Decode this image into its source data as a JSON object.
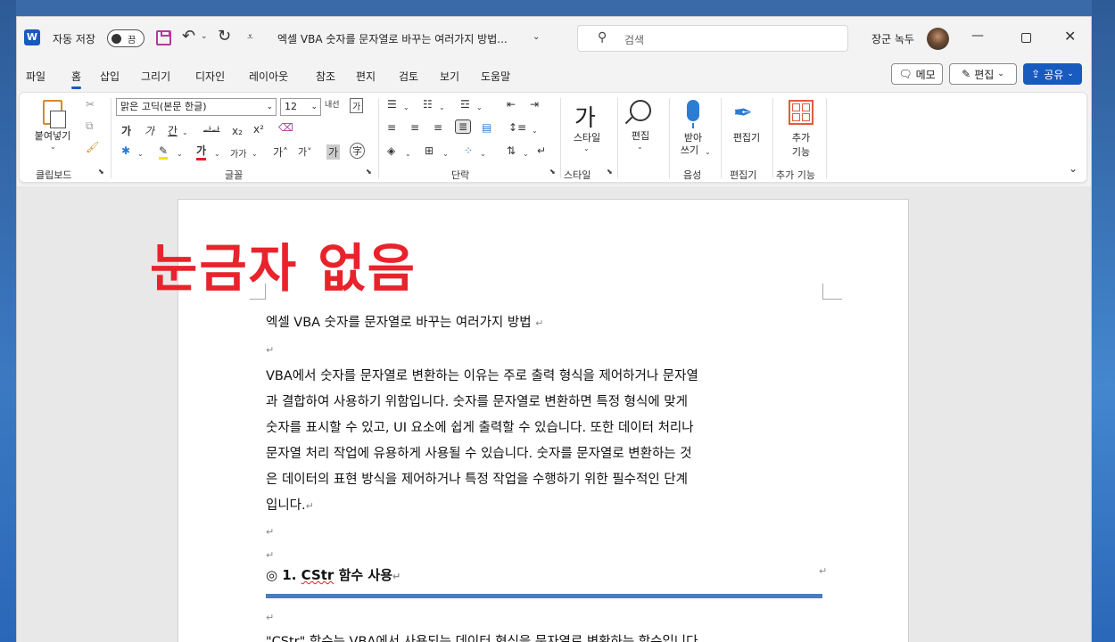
{
  "titlebar": {
    "app_icon": "W",
    "autosave_label": "자동 저장",
    "autosave_toggle": "끔",
    "doc_title": "엑셀 VBA 숫자를 문자열로 바꾸는 여러가지 방법...",
    "search_placeholder": "검색",
    "user_name": "장군 녹두"
  },
  "tabs": [
    "파일",
    "홈",
    "삽입",
    "그리기",
    "디자인",
    "레이아웃",
    "참조",
    "편지",
    "검토",
    "보기",
    "도움말"
  ],
  "active_tab": "홈",
  "actions": {
    "memo": "메모",
    "edit": "편집",
    "share": "공유"
  },
  "ribbon": {
    "clipboard": {
      "paste": "붙여넣기",
      "label": "클립보드"
    },
    "font": {
      "family": "맑은 고딕(본문 한글)",
      "size": "12",
      "label": "글꼴"
    },
    "paragraph": {
      "label": "단락"
    },
    "styles": {
      "button": "스타일",
      "label": "스타일"
    },
    "editing": {
      "button": "편집"
    },
    "voice": {
      "button_line1": "받아",
      "button_line2": "쓰기",
      "label": "음성"
    },
    "editor": {
      "button": "편집기",
      "label": "편집기"
    },
    "addins": {
      "button_line1": "추가",
      "button_line2": "기능",
      "label": "추가 기능"
    }
  },
  "document": {
    "overlay": "눈금자 없음",
    "title_line": "엑셀 VBA 숫자를 문자열로 바꾸는 여러가지 방법",
    "para_lines": [
      "VBA에서 숫자를 문자열로 변환하는 이유는 주로 출력 형식을 제어하거나 문자열",
      "과 결합하여 사용하기 위함입니다. 숫자를 문자열로 변환하면 특정 형식에 맞게",
      "숫자를 표시할 수 있고, UI 요소에 쉽게 출력할 수 있습니다. 또한 데이터 처리나",
      "문자열 처리 작업에 유용하게 사용될 수 있습니다. 숫자를 문자열로 변환하는 것",
      "은 데이터의 표현 방식을 제어하거나 특정 작업을 수행하기 위한 필수적인 단계",
      "입니다."
    ],
    "heading_prefix": "◎ 1. ",
    "heading_func": "CStr",
    "heading_suffix": " 함수 사용",
    "last_line": "\"CStr\" 함수는 VBA에서 사용되는 데이터 형식을 문자열로 변환하는 함수입니다."
  },
  "colors": {
    "accent": "#185abd",
    "overlay": "#e8232b",
    "heading_rule": "#4a7cc2"
  }
}
